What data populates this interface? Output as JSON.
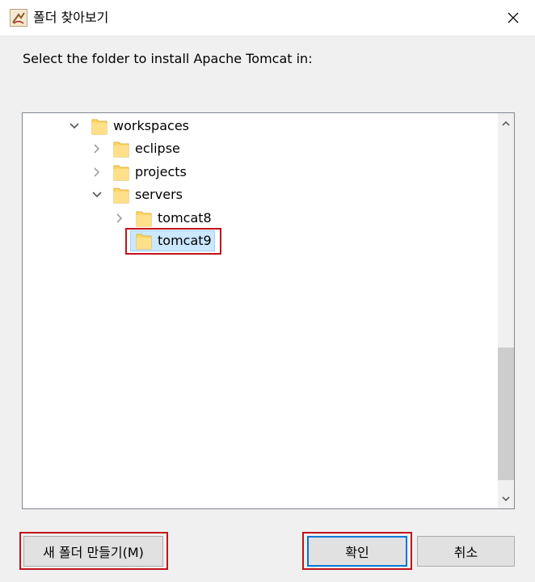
{
  "window": {
    "title": "폴더 찾아보기",
    "app_icon": "java-coffee-icon",
    "close_icon": "close-icon"
  },
  "instruction": "Select the folder to install Apache Tomcat in:",
  "tree": {
    "nodes": [
      {
        "label": "workspaces",
        "expanded": true,
        "twisty": "chevron-down"
      },
      {
        "label": "eclipse",
        "expanded": false,
        "twisty": "chevron-right"
      },
      {
        "label": "projects",
        "expanded": false,
        "twisty": "chevron-right"
      },
      {
        "label": "servers",
        "expanded": true,
        "twisty": "chevron-down"
      },
      {
        "label": "tomcat8",
        "expanded": false,
        "twisty": "chevron-right"
      },
      {
        "label": "tomcat9",
        "selected": true,
        "twisty": "none"
      }
    ]
  },
  "buttons": {
    "new_folder": "새 폴더 만들기(M)",
    "ok": "확인",
    "cancel": "취소"
  },
  "colors": {
    "selection": "#cce8ff",
    "annotation_red": "#c0141b",
    "default_button_border": "#0078d7",
    "folder_yellow": "#ffd766"
  }
}
